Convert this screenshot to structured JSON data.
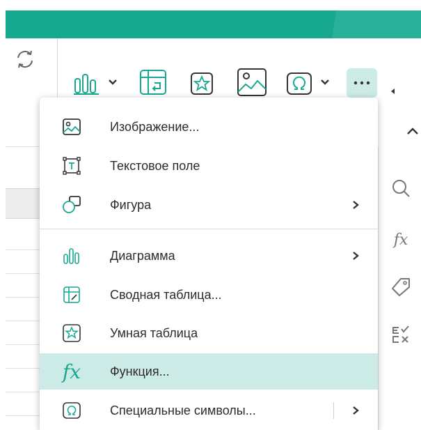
{
  "colors": {
    "accent": "#17a990",
    "selected_bg": "#cdebe6",
    "menu_text": "#2b2b2b",
    "icon_gray": "#555555"
  },
  "left_panel": {
    "refresh_icon": "refresh-icon"
  },
  "toolbar": {
    "buttons": [
      {
        "icon": "chart-icon",
        "has_dropdown": true
      },
      {
        "icon": "pivot-table-icon"
      },
      {
        "icon": "smart-table-icon"
      },
      {
        "icon": "image-icon"
      },
      {
        "icon": "omega-icon",
        "has_dropdown": true
      },
      {
        "icon": "more-icon",
        "active": true
      }
    ]
  },
  "right_rail": {
    "collapse_icon": "chevron-up-icon",
    "items": [
      {
        "icon": "search-icon"
      },
      {
        "icon": "function-icon",
        "label": "fx"
      },
      {
        "icon": "tag-icon"
      },
      {
        "icon": "checklist-icon"
      }
    ]
  },
  "menu": {
    "items": [
      {
        "label": "Изображение...",
        "icon": "image-icon"
      },
      {
        "label": "Текстовое поле",
        "icon": "text-box-icon"
      },
      {
        "label": "Фигура",
        "icon": "shape-icon",
        "submenu": true
      },
      {
        "label": "Диаграмма",
        "icon": "chart-icon",
        "submenu": true
      },
      {
        "label": "Сводная таблица...",
        "icon": "pivot-table-icon"
      },
      {
        "label": "Умная таблица",
        "icon": "smart-table-icon"
      },
      {
        "label": "Функция...",
        "icon": "function-icon",
        "icon_text": "fx",
        "selected": true
      },
      {
        "label": "Специальные символы...",
        "icon": "omega-icon",
        "submenu": true
      }
    ]
  }
}
